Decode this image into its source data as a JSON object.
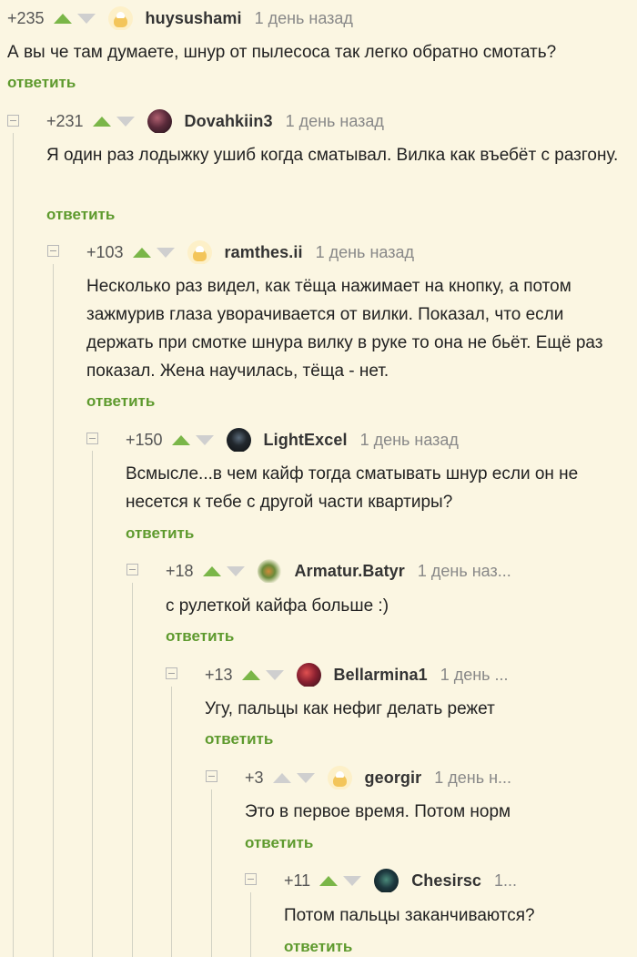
{
  "reply_label": "ответить",
  "comments": [
    {
      "rating": "+235",
      "username": "huysushami",
      "time": "1 день назад",
      "text": "А вы че там думаете, шнур от пылесоса так легко обратно смотать?",
      "avatar": "default-avatar",
      "upvote_active": true
    },
    {
      "rating": "+231",
      "username": "Dovahkiin3",
      "time": "1 день назад",
      "text": "Я один раз лодыжку ушиб когда сматывал. Вилка как въебёт с разгону.",
      "avatar": "user-photo-avatar",
      "upvote_active": true
    },
    {
      "rating": "+103",
      "username": "ramthes.ii",
      "time": "1 день назад",
      "text": "Несколько раз видел, как тёща нажимает на кнопку, а потом зажмурив глаза уворачивается от вилки. Показал, что если держать при смотке шнура вилку в руке то она не бьёт. Ещё раз показал. Жена научилась, тёща - нет.",
      "avatar": "default-avatar",
      "upvote_active": true
    },
    {
      "rating": "+150",
      "username": "LightExcel",
      "time": "1 день назад",
      "text": "Всмысле...в чем кайф тогда сматывать шнур если он не несется к тебе с другой части квартиры?",
      "avatar": "user-photo-avatar",
      "upvote_active": true
    },
    {
      "rating": "+18",
      "username": "Armatur.Batyr",
      "time": "1 день наз...",
      "text": "с рулеткой кайфа больше :)",
      "avatar": "user-photo-avatar",
      "upvote_active": true
    },
    {
      "rating": "+13",
      "username": "Bellarmina1",
      "time": "1 день ...",
      "text": "Угу, пальцы как нефиг делать режет",
      "avatar": "user-photo-avatar",
      "upvote_active": true
    },
    {
      "rating": "+3",
      "username": "georgir",
      "time": "1 день н...",
      "text": "Это в первое время. Потом норм",
      "avatar": "default-avatar",
      "upvote_active": false
    },
    {
      "rating": "+11",
      "username": "Chesirsc",
      "time": "1...",
      "text": "Потом пальцы заканчиваются?",
      "avatar": "user-photo-avatar",
      "upvote_active": true
    }
  ]
}
